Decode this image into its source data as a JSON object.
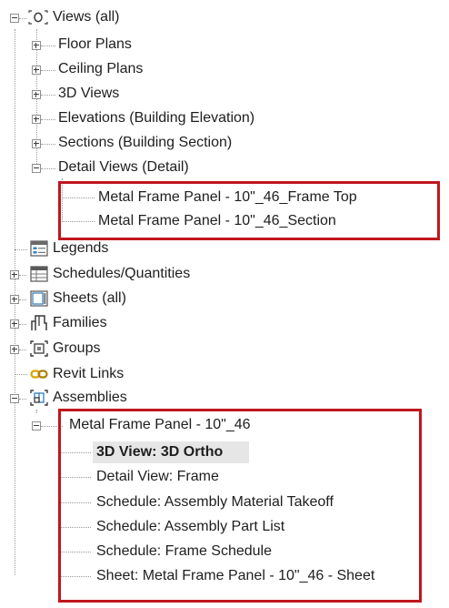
{
  "tree": {
    "views_root": "Views (all)",
    "view_types": [
      "Floor Plans",
      "Ceiling Plans",
      "3D Views",
      "Elevations (Building Elevation)",
      "Sections (Building Section)",
      "Detail Views (Detail)"
    ],
    "detail_views": [
      "Metal Frame Panel - 10\"_46_Frame Top",
      "Metal Frame Panel - 10\"_46_Section"
    ],
    "legends": "Legends",
    "schedules": "Schedules/Quantities",
    "sheets": "Sheets (all)",
    "families": "Families",
    "groups": "Groups",
    "revit_links": "Revit Links",
    "assemblies": "Assemblies",
    "assembly_name": "Metal Frame Panel - 10\"_46",
    "assembly_views": [
      "3D View: 3D Ortho",
      "Detail View: Frame",
      "Schedule: Assembly Material Takeoff",
      "Schedule: Assembly Part List",
      "Schedule: Frame Schedule",
      "Sheet: Metal Frame Panel - 10\"_46 - Sheet"
    ],
    "selected_item": "3D View: 3D Ortho"
  },
  "colors": {
    "highlight_border": "#c0161e",
    "selection_background": "#e6e6e6"
  }
}
